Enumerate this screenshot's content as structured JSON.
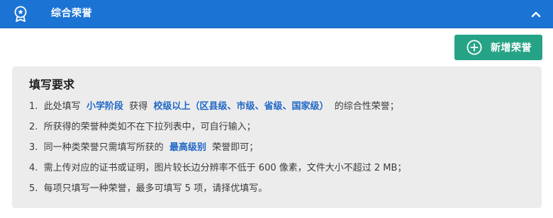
{
  "header": {
    "title": "综合荣誉",
    "icon": "award-icon",
    "collapse_icon": "chevron-up-icon",
    "bg_color": "#1b74d4"
  },
  "actions": {
    "add_label": "新增荣誉",
    "add_icon": "plus-circle-icon",
    "button_color": "#26a386"
  },
  "notice": {
    "title": "填写要求",
    "highlight_color": "#2168c6",
    "rules": [
      {
        "num": "1.",
        "t1": "此处填写",
        "h1": "小学阶段",
        "t2": "获得",
        "h2": "校级以上（区县级、市级、省级、国家级）",
        "t3": "的综合性荣誉；"
      },
      {
        "num": "2.",
        "t1": "所获得的荣誉种类如不在下拉列表中，可自行输入；"
      },
      {
        "num": "3.",
        "t1": "同一种类荣誉只需填写所获的",
        "h1": "最高级别",
        "t2": "荣誉即可；"
      },
      {
        "num": "4.",
        "t1": "需上传对应的证书或证明，图片较长边分辨率不低于 600 像素，文件大小不超过 2 MB；"
      },
      {
        "num": "5.",
        "t1": "每项只填写一种荣誉，最多可填写 5 项，请择优填写。"
      }
    ]
  }
}
